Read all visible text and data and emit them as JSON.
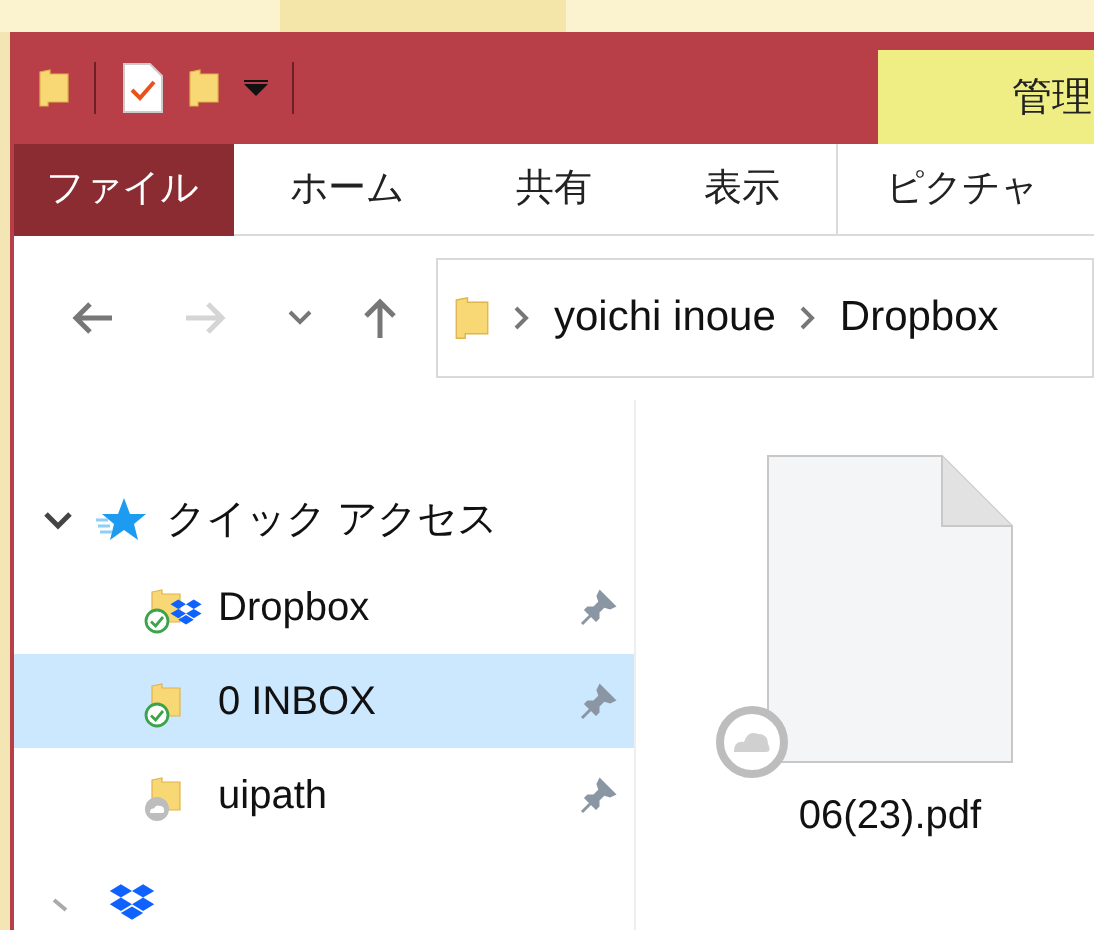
{
  "context_tab": {
    "label": "管理"
  },
  "ribbon_tabs": [
    {
      "label": "ファイル",
      "kind": "file"
    },
    {
      "label": "ホーム",
      "kind": "tab",
      "selected": false
    },
    {
      "label": "共有",
      "kind": "tab",
      "selected": false
    },
    {
      "label": "表示",
      "kind": "tab",
      "selected": false
    },
    {
      "label": "ピクチャ",
      "kind": "tab",
      "selected": false
    }
  ],
  "navigation": {
    "back_disabled": false,
    "forward_disabled": true
  },
  "address": {
    "segments": [
      "yoichi inoue",
      "Dropbox"
    ]
  },
  "tree": [
    {
      "label": "クイック アクセス",
      "expanded": true,
      "children": [
        {
          "label": "Dropbox",
          "selected": false,
          "pinned": true,
          "synced": true,
          "kind": "dropbox"
        },
        {
          "label": "0 INBOX",
          "selected": true,
          "pinned": true,
          "synced": true,
          "kind": "folder"
        },
        {
          "label": "uipath",
          "selected": false,
          "pinned": true,
          "synced": false,
          "kind": "folder"
        }
      ]
    }
  ],
  "files": [
    {
      "name": "06(23).pdf",
      "cloud_only": true
    }
  ]
}
